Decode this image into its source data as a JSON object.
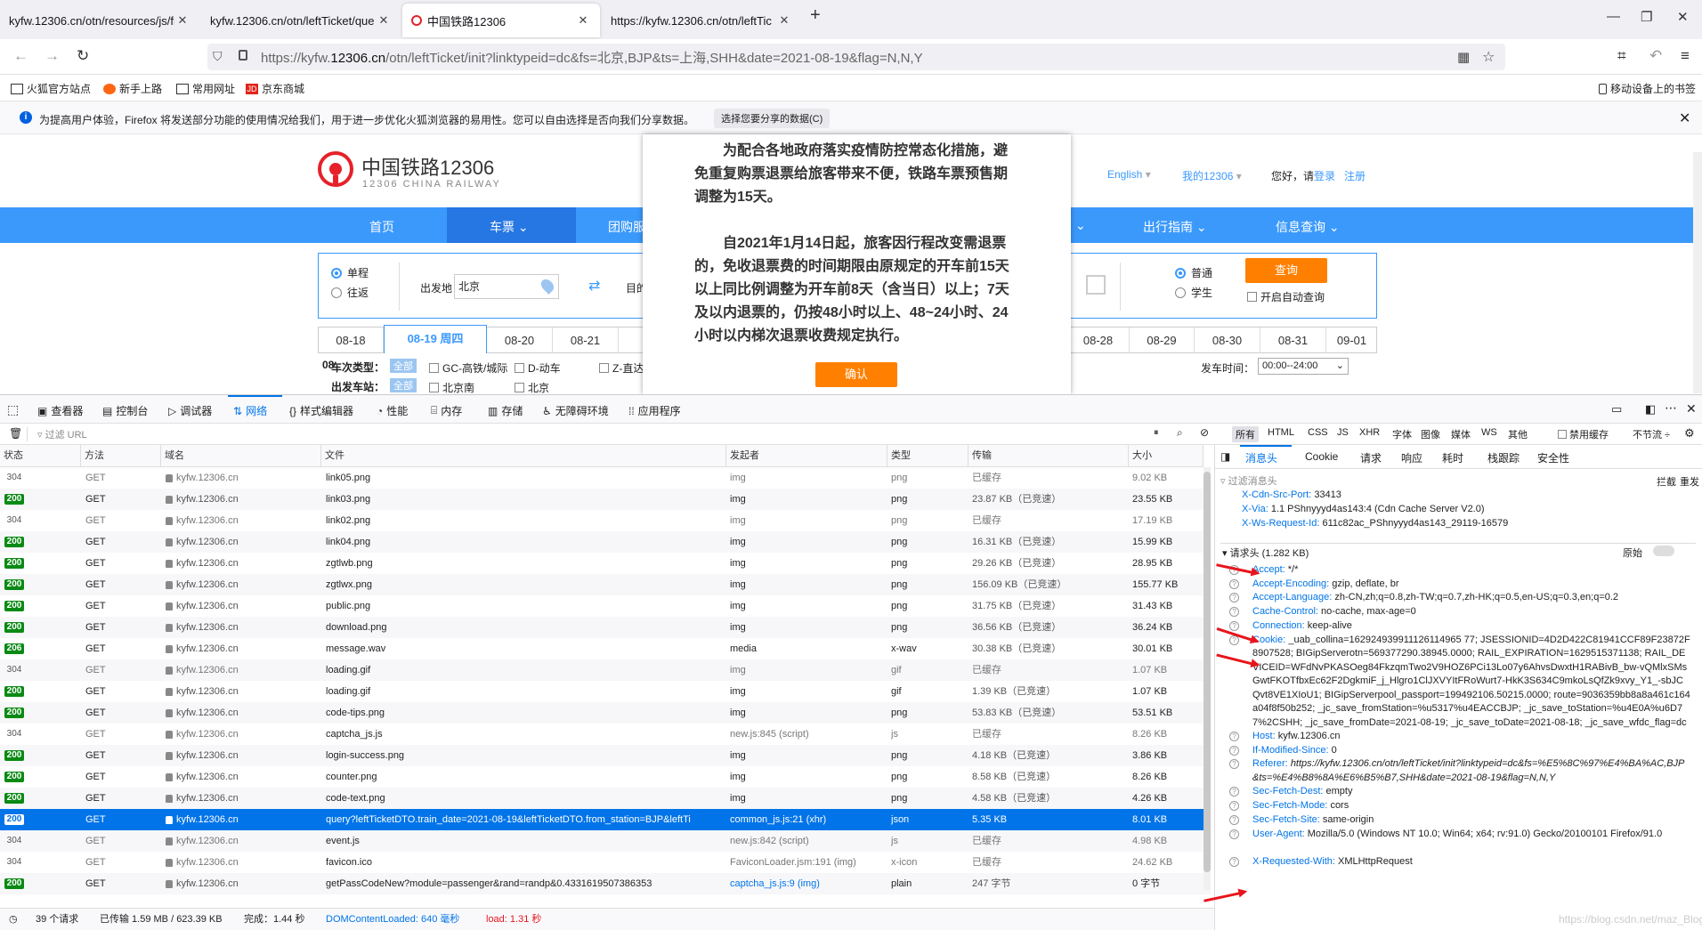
{
  "browser": {
    "tabs": [
      {
        "title": "kyfw.12306.cn/otn/resources/js/fr"
      },
      {
        "title": "kyfw.12306.cn/otn/leftTicket/que"
      },
      {
        "title": "中国铁路12306"
      },
      {
        "title": "https://kyfw.12306.cn/otn/leftTic"
      }
    ],
    "url_prefix": "https://kyfw.",
    "url_domain": "12306.cn",
    "url_rest": "/otn/leftTicket/init?linktypeid=dc&fs=北京,BJP&ts=上海,SHH&date=2021-08-19&flag=N,N,Y",
    "bookmarks": [
      "火狐官方站点",
      "新手上路",
      "常用网址",
      "京东商城"
    ],
    "mobile_bookmarks": "移动设备上的书签",
    "notice_text": "为提高用户体验，Firefox 将发送部分功能的使用情况给我们，用于进一步优化火狐浏览器的易用性。您可以自由选择是否向我们分享数据。",
    "notice_button": "选择您要分享的数据(C)"
  },
  "site": {
    "logo_cn": "中国铁路12306",
    "logo_en": "12306 CHINA RAILWAY",
    "top_links": {
      "english": "English",
      "my12306": "我的12306",
      "greeting": "您好，请",
      "login": "登录",
      "register": "注册"
    },
    "nav": [
      "首页",
      "车票",
      "团购服",
      "出行指南",
      "信息查询"
    ],
    "trip_single": "单程",
    "trip_return": "往返",
    "from_label": "出发地",
    "from_value": "北京",
    "to_label": "目的",
    "pax_normal": "普通",
    "pax_student": "学生",
    "query_button": "查询",
    "auto_query": "开启自动查询",
    "dates_left": [
      "08-18",
      "08-19 周四",
      "08-20",
      "08-21"
    ],
    "dates_right": [
      "08-28",
      "08-29",
      "08-30",
      "08-31",
      "09-01"
    ],
    "train_type_label": "车次类型：",
    "all_label": "全部",
    "train_types": [
      "GC-高铁/城际",
      "D-动车",
      "Z-直达"
    ],
    "depart_station_label": "出发车站：",
    "depart_stations": [
      "北京南",
      "北京"
    ],
    "depart_time_label": "发车时间：",
    "depart_time_value": "00:00--24:00",
    "row_prefix": "08"
  },
  "modal": {
    "para1": "为配合各地政府落实疫情防控常态化措施，避免重复购票退票给旅客带来不便，铁路车票预售期调整为15天。",
    "para2": "自2021年1月14日起，旅客因行程改变需退票的，免收退票费的时间期限由原规定的开车前15天以上同比例调整为开车前8天（含当日）以上；7天及以内退票的，仍按48小时以上、48~24小时、24小时以内梯次退票收费规定执行。",
    "confirm": "确认"
  },
  "devtools": {
    "tabs": [
      "查看器",
      "控制台",
      "调试器",
      "网络",
      "样式编辑器",
      "性能",
      "内存",
      "存储",
      "无障碍环境",
      "应用程序"
    ],
    "filter_placeholder": "过滤 URL",
    "type_filters": [
      "所有",
      "HTML",
      "CSS",
      "JS",
      "XHR",
      "字体",
      "图像",
      "媒体",
      "WS",
      "其他"
    ],
    "disable_cache": "禁用缓存",
    "throttle": "不节流 ÷",
    "columns": [
      "状态",
      "方法",
      "域名",
      "文件",
      "发起者",
      "类型",
      "传输",
      "大小"
    ],
    "rows": [
      {
        "status": "304",
        "method": "GET",
        "domain": "kyfw.12306.cn",
        "file": "link05.png",
        "initiator": "img",
        "type": "png",
        "transfer": "已缓存",
        "size": "9.02 KB"
      },
      {
        "status": "200",
        "method": "GET",
        "domain": "kyfw.12306.cn",
        "file": "link03.png",
        "initiator": "img",
        "type": "png",
        "transfer": "23.87 KB（已竞速）",
        "size": "23.55 KB"
      },
      {
        "status": "304",
        "method": "GET",
        "domain": "kyfw.12306.cn",
        "file": "link02.png",
        "initiator": "img",
        "type": "png",
        "transfer": "已缓存",
        "size": "17.19 KB"
      },
      {
        "status": "200",
        "method": "GET",
        "domain": "kyfw.12306.cn",
        "file": "link04.png",
        "initiator": "img",
        "type": "png",
        "transfer": "16.31 KB（已竞速）",
        "size": "15.99 KB"
      },
      {
        "status": "200",
        "method": "GET",
        "domain": "kyfw.12306.cn",
        "file": "zgtlwb.png",
        "initiator": "img",
        "type": "png",
        "transfer": "29.26 KB（已竞速）",
        "size": "28.95 KB"
      },
      {
        "status": "200",
        "method": "GET",
        "domain": "kyfw.12306.cn",
        "file": "zgtlwx.png",
        "initiator": "img",
        "type": "png",
        "transfer": "156.09 KB（已竞速）",
        "size": "155.77 KB"
      },
      {
        "status": "200",
        "method": "GET",
        "domain": "kyfw.12306.cn",
        "file": "public.png",
        "initiator": "img",
        "type": "png",
        "transfer": "31.75 KB（已竞速）",
        "size": "31.43 KB"
      },
      {
        "status": "200",
        "method": "GET",
        "domain": "kyfw.12306.cn",
        "file": "download.png",
        "initiator": "img",
        "type": "png",
        "transfer": "36.56 KB（已竞速）",
        "size": "36.24 KB"
      },
      {
        "status": "206",
        "method": "GET",
        "domain": "kyfw.12306.cn",
        "file": "message.wav",
        "initiator": "media",
        "type": "x-wav",
        "transfer": "30.38 KB（已竞速）",
        "size": "30.01 KB"
      },
      {
        "status": "304",
        "method": "GET",
        "domain": "kyfw.12306.cn",
        "file": "loading.gif",
        "initiator": "img",
        "type": "gif",
        "transfer": "已缓存",
        "size": "1.07 KB"
      },
      {
        "status": "200",
        "method": "GET",
        "domain": "kyfw.12306.cn",
        "file": "loading.gif",
        "initiator": "img",
        "type": "gif",
        "transfer": "1.39 KB（已竞速）",
        "size": "1.07 KB"
      },
      {
        "status": "200",
        "method": "GET",
        "domain": "kyfw.12306.cn",
        "file": "code-tips.png",
        "initiator": "img",
        "type": "png",
        "transfer": "53.83 KB（已竞速）",
        "size": "53.51 KB"
      },
      {
        "status": "304",
        "method": "GET",
        "domain": "kyfw.12306.cn",
        "file": "captcha_js.js",
        "initiator": "new.js:845 (script)",
        "type": "js",
        "transfer": "已缓存",
        "size": "8.26 KB"
      },
      {
        "status": "200",
        "method": "GET",
        "domain": "kyfw.12306.cn",
        "file": "login-success.png",
        "initiator": "img",
        "type": "png",
        "transfer": "4.18 KB（已竞速）",
        "size": "3.86 KB"
      },
      {
        "status": "200",
        "method": "GET",
        "domain": "kyfw.12306.cn",
        "file": "counter.png",
        "initiator": "img",
        "type": "png",
        "transfer": "8.58 KB（已竞速）",
        "size": "8.26 KB"
      },
      {
        "status": "200",
        "method": "GET",
        "domain": "kyfw.12306.cn",
        "file": "code-text.png",
        "initiator": "img",
        "type": "png",
        "transfer": "4.58 KB（已竞速）",
        "size": "4.26 KB"
      },
      {
        "status": "200",
        "method": "GET",
        "domain": "kyfw.12306.cn",
        "file": "query?leftTicketDTO.train_date=2021-08-19&leftTicketDTO.from_station=BJP&leftTi",
        "initiator": "common_js.js:21 (xhr)",
        "type": "json",
        "transfer": "5.35 KB",
        "size": "8.01 KB",
        "selected": true
      },
      {
        "status": "304",
        "method": "GET",
        "domain": "kyfw.12306.cn",
        "file": "event.js",
        "initiator": "new.js:842 (script)",
        "type": "js",
        "transfer": "已缓存",
        "size": "4.98 KB"
      },
      {
        "status": "304",
        "method": "GET",
        "domain": "kyfw.12306.cn",
        "file": "favicon.ico",
        "initiator": "FaviconLoader.jsm:191 (img)",
        "type": "x-icon",
        "transfer": "已缓存",
        "size": "24.62 KB"
      },
      {
        "status": "200",
        "method": "GET",
        "domain": "kyfw.12306.cn",
        "file": "getPassCodeNew?module=passenger&rand=randp&0.4331619507386353",
        "initiator": "captcha_js.js:9 (img)",
        "type": "plain",
        "transfer": "247 字节",
        "size": "0 字节"
      }
    ],
    "status_bar": {
      "requests": "39 个请求",
      "transferred": "已传输 1.59 MB / 623.39 KB",
      "finish": "完成：1.44 秒",
      "dom_loaded": "DOMContentLoaded: 640 毫秒",
      "load": "load: 1.31 秒"
    },
    "side_tabs": [
      "消息头",
      "Cookie",
      "请求",
      "响应",
      "耗时",
      "栈跟踪",
      "安全性"
    ],
    "side_filter_placeholder": "过滤消息头",
    "block_label": "拦截",
    "resend_label": "重发",
    "response_headers": [
      {
        "k": "X-Cdn-Src-Port:",
        "v": "33413"
      },
      {
        "k": "X-Via:",
        "v": "1.1 PShnyyyd4as143:4 (Cdn Cache Server V2.0)"
      },
      {
        "k": "X-Ws-Request-Id:",
        "v": "611c82ac_PShnyyyd4as143_29119-16579"
      }
    ],
    "request_headers_title": "请求头 (1.282 KB)",
    "raw_label": "原始",
    "request_headers": [
      {
        "k": "Accept:",
        "v": "*/*"
      },
      {
        "k": "Accept-Encoding:",
        "v": "gzip, deflate, br"
      },
      {
        "k": "Accept-Language:",
        "v": "zh-CN,zh;q=0.8,zh-TW;q=0.7,zh-HK;q=0.5,en-US;q=0.3,en;q=0.2"
      },
      {
        "k": "Cache-Control:",
        "v": "no-cache, max-age=0"
      },
      {
        "k": "Connection:",
        "v": "keep-alive"
      },
      {
        "k": "Cookie:",
        "v": "_uab_collina=162924939911126114965 77; JSESSIONID=4D2D422C81941CCF89F23872F8907528; BIGipServerotn=569377290.38945.0000; RAIL_EXPIRATION=1629515371138; RAIL_DEVICEID=WFdNvPKASOeg84FkzqmTwo2V9HOZ6PCi13Lo07y6AhvsDwxtH1RABivB_bw-vQMlxSMsGwtFKOTfbxEc62F2DgkmiF_j_Hlgro1ClJXVYItFRoWurt7-HkK3S634C9mkoLsQfZk9xvy_Y1_-sbJCQvt8VE1XIoU1; BIGipServerpool_passport=199492106.50215.0000; route=9036359bb8a8a461c164a04f8f50b252; _jc_save_fromStation=%u5317%u4EACCBJP; _jc_save_toStation=%u4E0A%u6D77%2CSHH; _jc_save_fromDate=2021-08-19; _jc_save_toDate=2021-08-18; _jc_save_wfdc_flag=dc"
      },
      {
        "k": "Host:",
        "v": "kyfw.12306.cn"
      },
      {
        "k": "If-Modified-Since:",
        "v": "0"
      },
      {
        "k": "Referer:",
        "v": "https://kyfw.12306.cn/otn/leftTicket/init?linktypeid=dc&fs=%E5%8C%97%E4%BA%AC,BJP&ts=%E4%B8%8A%E6%B5%B7,SHH&date=2021-08-19&flag=N,N,Y"
      },
      {
        "k": "Sec-Fetch-Dest:",
        "v": "empty"
      },
      {
        "k": "Sec-Fetch-Mode:",
        "v": "cors"
      },
      {
        "k": "Sec-Fetch-Site:",
        "v": "same-origin"
      },
      {
        "k": "User-Agent:",
        "v": "Mozilla/5.0 (Windows NT 10.0; Win64; x64; rv:91.0) Gecko/20100101 Firefox/91.0"
      },
      {
        "k": "X-Requested-With:",
        "v": "XMLHttpRequest"
      }
    ],
    "watermark": "https://blog.csdn.net/maz_Blog"
  },
  "colors": {
    "accent": "#3b99fc",
    "selected_row": "#0074e8",
    "status_ok": "#0a8a14",
    "logo_red": "#e62129",
    "button_orange": "#ff8000",
    "annotation_arrow": "#e8141b"
  }
}
